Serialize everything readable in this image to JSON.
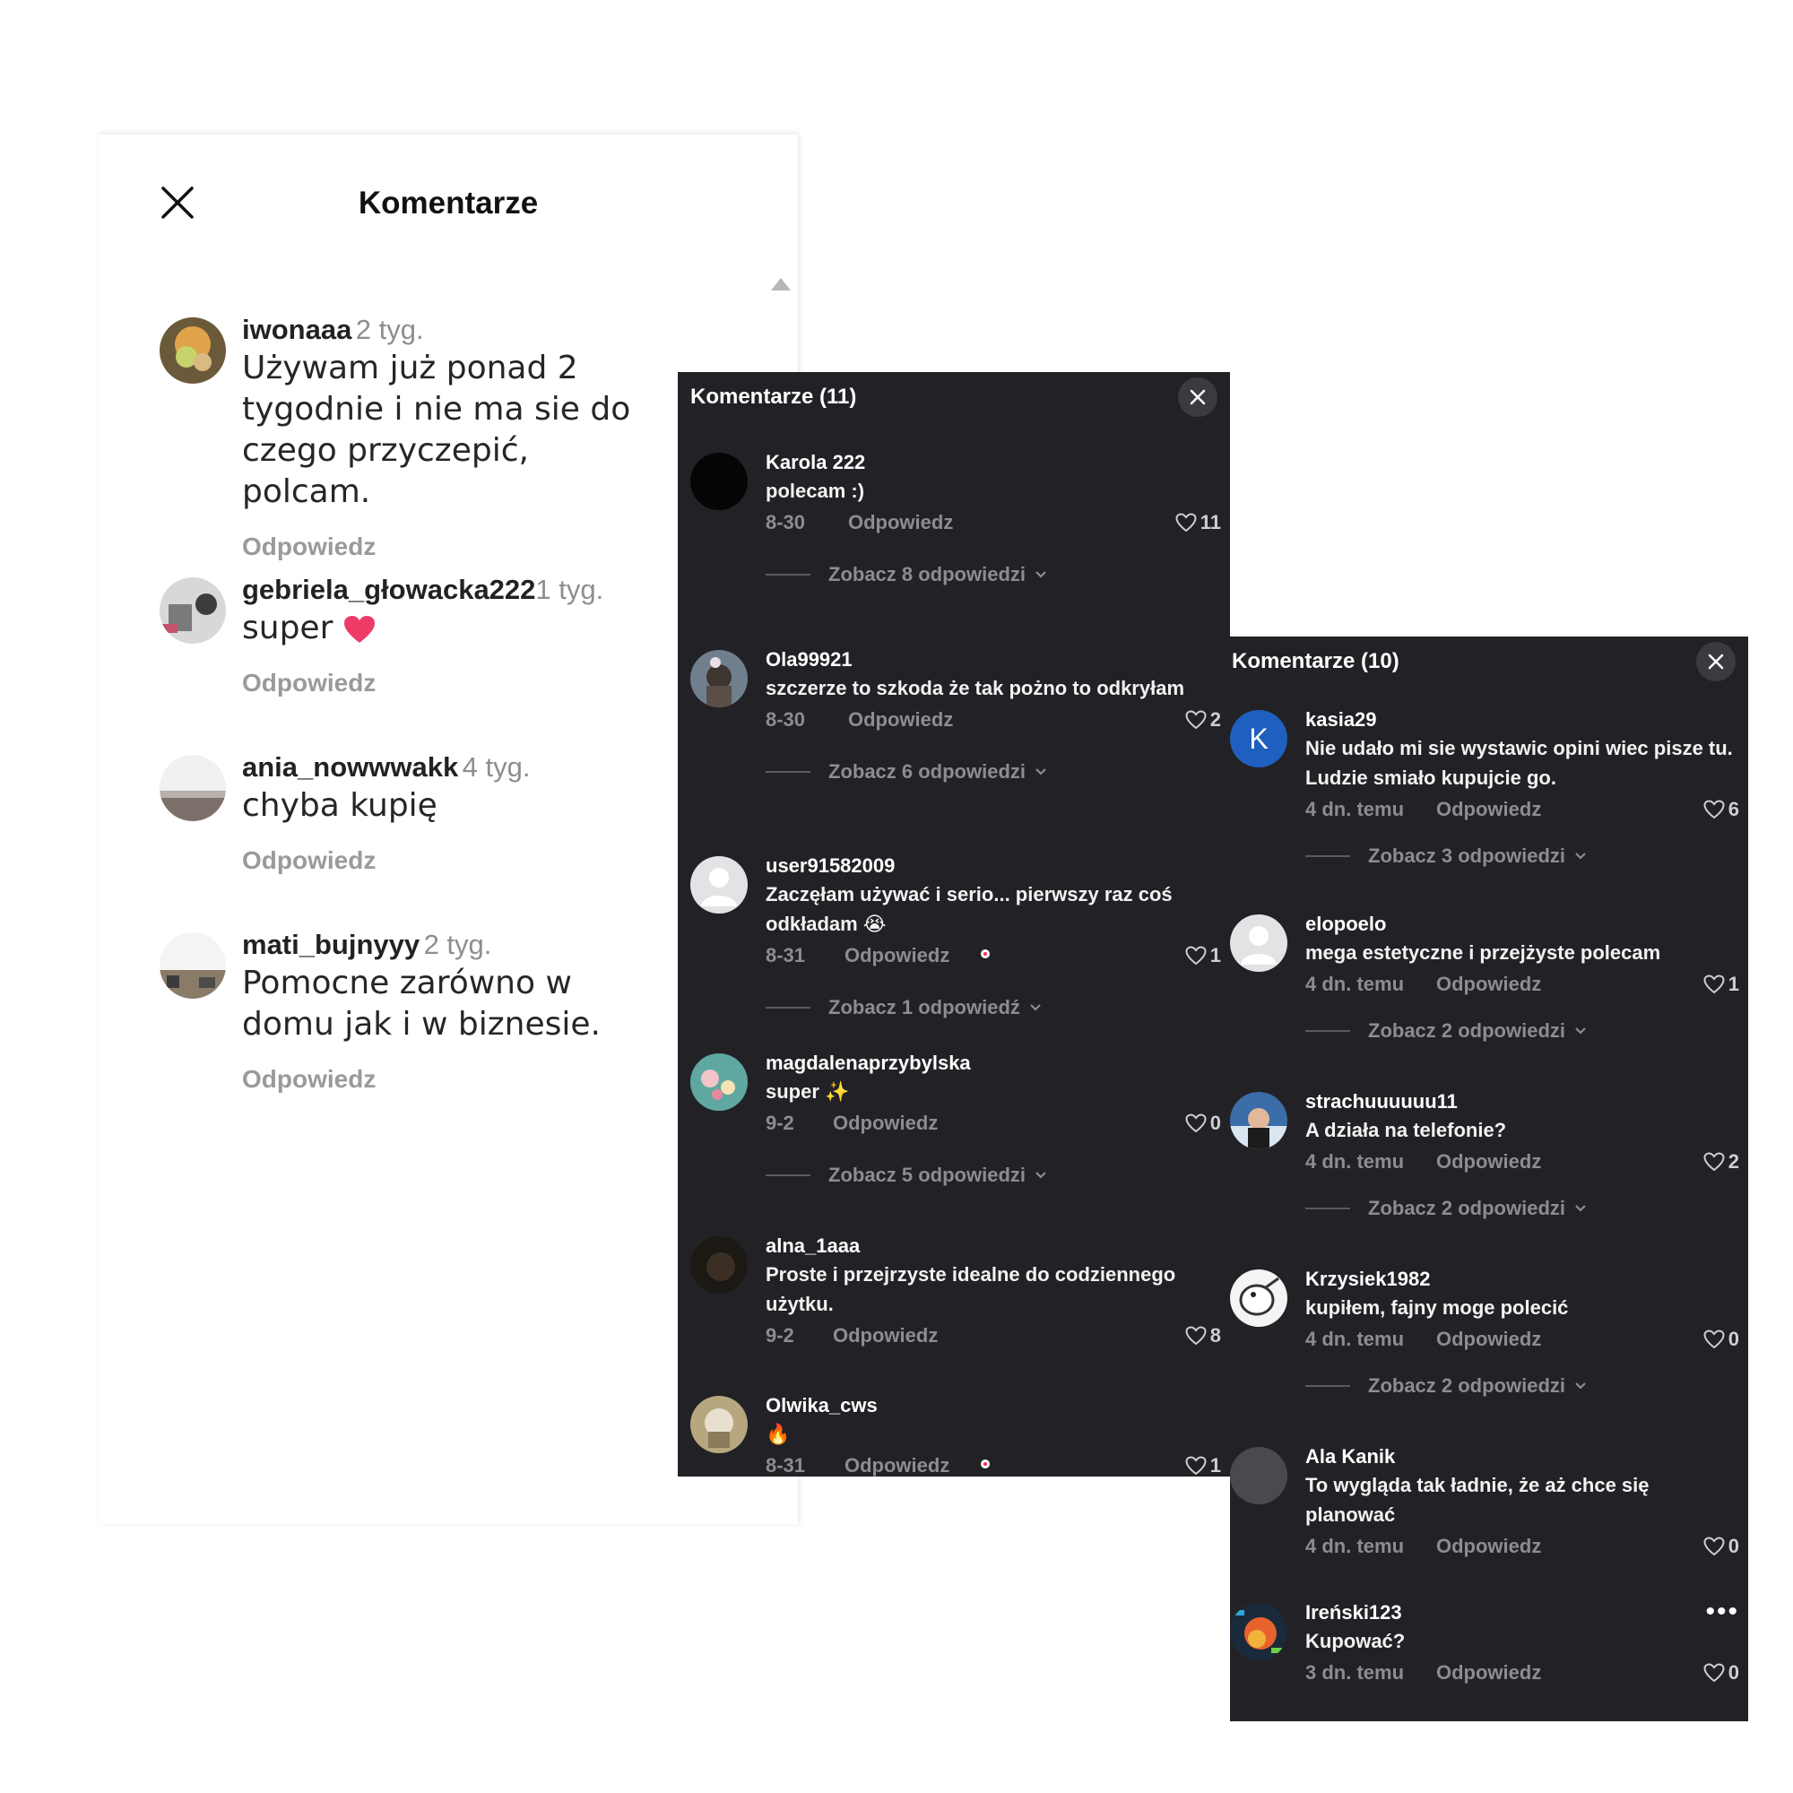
{
  "light_panel": {
    "title": "Komentarze",
    "comments": [
      {
        "user": "iwonaaa",
        "time": "2 tyg.",
        "text": "Używam już ponad 2 tygodnie i nie ma sie do czego przyczepić, polcam.",
        "reply": "Odpowiedz"
      },
      {
        "user": "gebriela_głowacka222",
        "time": "1 tyg.",
        "text": "super",
        "reply": "Odpowiedz"
      },
      {
        "user": "ania_nowwwakk",
        "time": "4 tyg.",
        "text": "chyba kupię",
        "reply": "Odpowiedz"
      },
      {
        "user": "mati_bujnyyy",
        "time": "2 tyg.",
        "text": "Pomocne zarówno w domu jak i w biznesie.",
        "reply": "Odpowiedz"
      }
    ]
  },
  "dark_panel_1": {
    "title": "Komentarze (11)",
    "comments": [
      {
        "user": "Karola 222",
        "text": "polecam :)",
        "date": "8-30",
        "reply": "Odpowiedz",
        "likes": "11",
        "view_replies": "Zobacz 8 odpowiedzi"
      },
      {
        "user": "Ola99921",
        "text": "szczerze to szkoda że tak pożno to odkryłam",
        "date": "8-30",
        "reply": "Odpowiedz",
        "likes": "2",
        "view_replies": "Zobacz 6 odpowiedzi"
      },
      {
        "user": "user91582009",
        "text": "Zaczęłam używać i serio... pierwszy raz coś odkładam 😭",
        "date": "8-31",
        "reply": "Odpowiedz",
        "likes": "1",
        "view_replies": "Zobacz 1 odpowiedź"
      },
      {
        "user": "magdalenaprzybylska",
        "text": "super ✨",
        "date": "9-2",
        "reply": "Odpowiedz",
        "likes": "0",
        "view_replies": "Zobacz 5 odpowiedzi"
      },
      {
        "user": "alna_1aaa",
        "text": "Proste i przejrzyste idealne do codziennego użytku.",
        "date": "9-2",
        "reply": "Odpowiedz",
        "likes": "8"
      },
      {
        "user": "Olwika_cws",
        "text": "🔥",
        "date": "8-31",
        "reply": "Odpowiedz",
        "likes": "1"
      }
    ]
  },
  "dark_panel_2": {
    "title": "Komentarze (10)",
    "comments": [
      {
        "user": "kasia29",
        "avatar_letter": "K",
        "text": "Nie udało mi sie wystawic opini wiec pisze tu. Ludzie smiało kupujcie go.",
        "date": "4 dn. temu",
        "reply": "Odpowiedz",
        "likes": "6",
        "view_replies": "Zobacz 3 odpowiedzi"
      },
      {
        "user": "elopoelo",
        "text": "mega estetyczne i przejżyste polecam",
        "date": "4 dn. temu",
        "reply": "Odpowiedz",
        "likes": "1",
        "view_replies": "Zobacz 2 odpowiedzi"
      },
      {
        "user": "strachuuuuuu11",
        "text": "A działa na telefonie?",
        "date": "4 dn. temu",
        "reply": "Odpowiedz",
        "likes": "2",
        "view_replies": "Zobacz 2 odpowiedzi"
      },
      {
        "user": "Krzysiek1982",
        "text": "kupiłem, fajny moge polecić",
        "date": "4 dn. temu",
        "reply": "Odpowiedz",
        "likes": "0",
        "view_replies": "Zobacz 2 odpowiedzi"
      },
      {
        "user": "Ala Kanik",
        "text": "To wygląda tak ładnie, że aż chce się planować",
        "date": "4 dn. temu",
        "reply": "Odpowiedz",
        "likes": "0"
      },
      {
        "user": "Ireński123",
        "text": "Kupować?",
        "date": "3 dn. temu",
        "reply": "Odpowiedz",
        "likes": "0"
      }
    ]
  },
  "colors": {
    "dark_bg": "#222226",
    "accent_blue": "#1f5fbf",
    "notify_red": "#fe2c55",
    "heart_pink": "#ee3b66"
  }
}
